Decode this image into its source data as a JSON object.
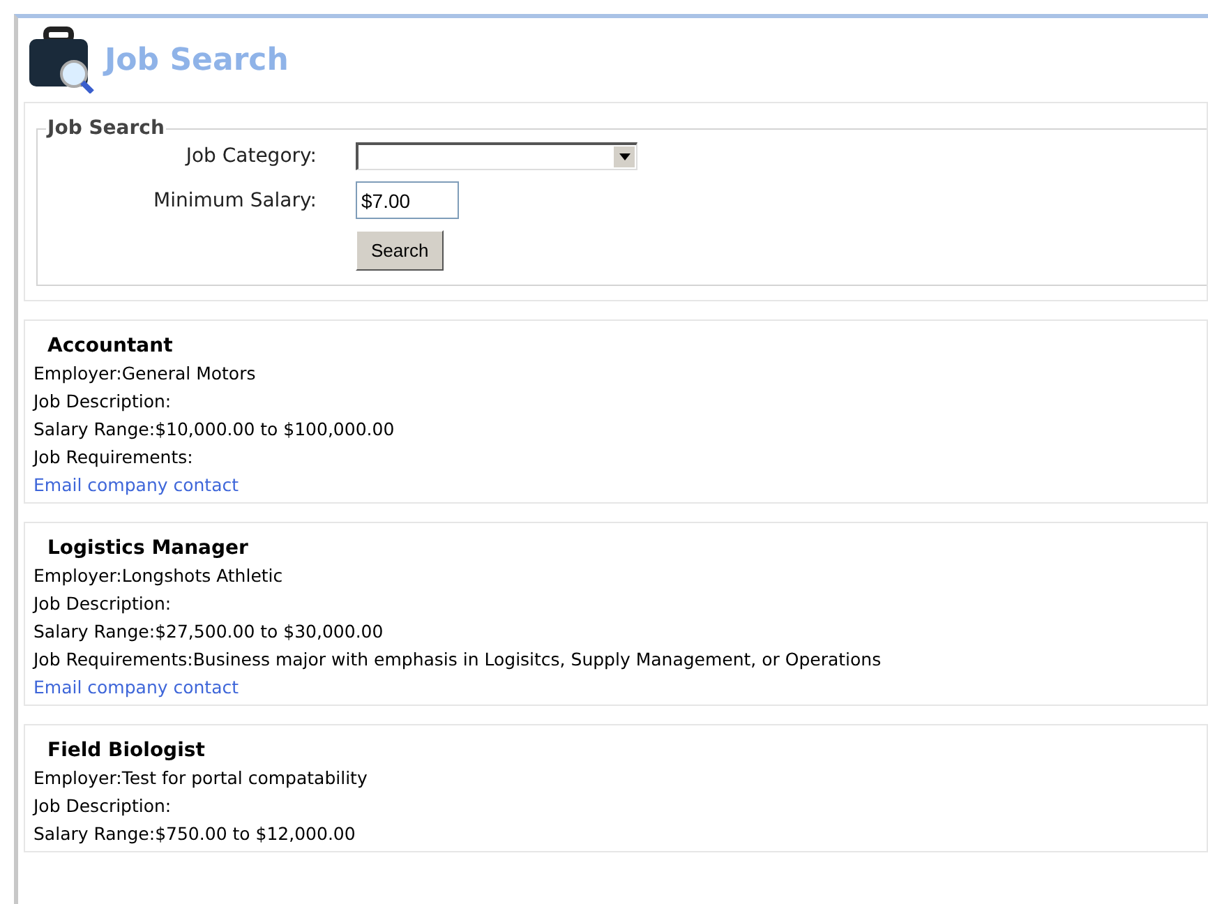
{
  "header": {
    "title": "Job Search"
  },
  "search_form": {
    "legend": "Job Search",
    "fields": [
      {
        "kind": "select",
        "label": "Job Category:"
      },
      {
        "kind": "text",
        "label": "Minimum Salary:",
        "value": "$7.00"
      }
    ],
    "button": "Search"
  },
  "jobs": [
    {
      "title": "Accountant",
      "lines": [
        {
          "label": "Employer:",
          "value": "General Motors"
        },
        {
          "label": "Job Description:"
        },
        {
          "label": "Salary Range:",
          "value": "$10,000.00 to $100,000.00"
        },
        {
          "label": "Job Requirements:"
        }
      ],
      "link": "Email company contact"
    },
    {
      "title": "Logistics Manager",
      "lines": [
        {
          "label": "Employer:",
          "value": "Longshots Athletic"
        },
        {
          "label": "Job Description:"
        },
        {
          "label": "Salary Range:",
          "value": "$27,500.00 to $30,000.00"
        },
        {
          "label": "Job Requirements:",
          "value": "Business major with emphasis in Logisitcs, Supply Management, or Operations"
        }
      ],
      "link": "Email company contact"
    },
    {
      "title": "Field Biologist",
      "lines": [
        {
          "label": "Employer:",
          "value": "Test for portal compatability"
        },
        {
          "label": "Job Description:"
        },
        {
          "label": "Salary Range:",
          "value": "$750.00 to $12,000.00"
        }
      ]
    }
  ]
}
